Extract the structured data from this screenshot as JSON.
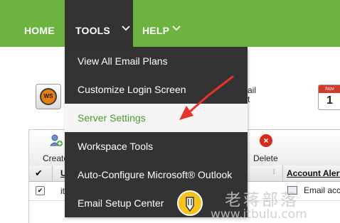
{
  "nav": {
    "home_label": "HOME",
    "tools_label": "TOOLS",
    "help_label": "HELP"
  },
  "tools_menu": {
    "items": [
      {
        "label": "View All Email Plans"
      },
      {
        "label": "Customize Login Screen"
      },
      {
        "label": "Server Settings"
      },
      {
        "label": "Workspace Tools"
      },
      {
        "label": "Auto-Configure Microsoft® Outlook"
      },
      {
        "label": "Email Setup Center"
      }
    ],
    "active_item": "Server Settings"
  },
  "background": {
    "ws_icon_text": "WS",
    "ail_text_line1": "ail",
    "ail_text_line2": "t",
    "calendar_month": "Nov",
    "calendar_day": "1",
    "toolbar": {
      "create_label": "Create",
      "delete_label": "Delete"
    },
    "grid": {
      "columns": [
        "U",
        "Account Alerts"
      ],
      "rows": [
        {
          "user": "it",
          "alert": "Email account"
        }
      ]
    }
  },
  "watermark": {
    "chinese_text": "老蒋部落",
    "url_text": "www.itbulu.com"
  },
  "colors": {
    "nav_green": "#6cb33f",
    "menu_dark": "#333333",
    "active_text": "#4a9a2f",
    "annotation_red": "#e8332a"
  },
  "icons": {
    "tools_chevron": "chevron-down-icon",
    "help_chevron": "chevron-down-icon",
    "create_icon": "add-user-icon",
    "delete_icon": "delete-icon",
    "email_icon": "email-icon",
    "calendar_icon": "calendar-icon",
    "ws_icon": "workspace-icon",
    "annotation_arrow": "red-arrow-icon",
    "watermark_logo": "pencil-logo-icon"
  }
}
